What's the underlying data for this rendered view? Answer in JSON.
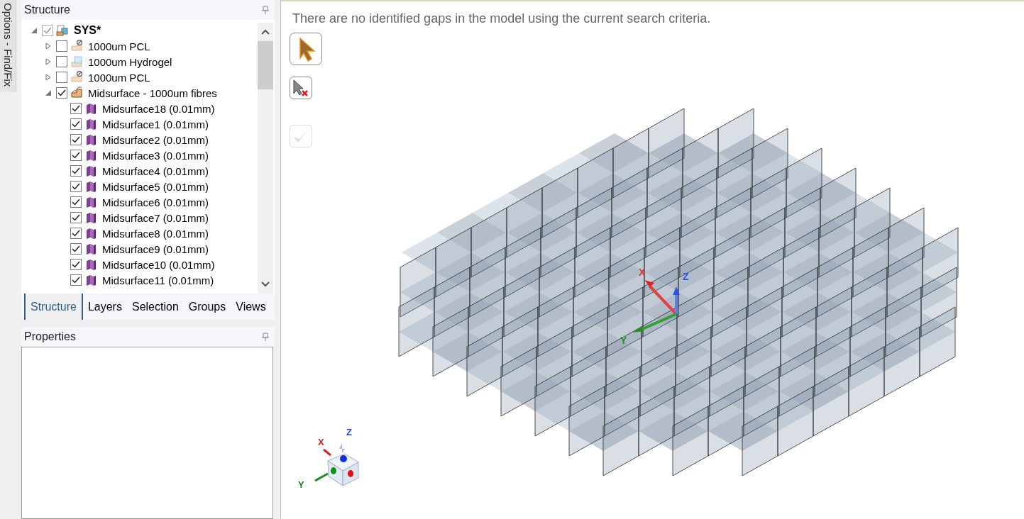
{
  "side_strip": {
    "label": "Options - Find/Fix"
  },
  "structure": {
    "title": "Structure",
    "tree": [
      {
        "label": "SYS*",
        "kind": "assembly",
        "checked": true,
        "expanded": true,
        "children": [
          {
            "label": "1000um PCL",
            "kind": "hidden-solid",
            "checked": false,
            "expanded": false
          },
          {
            "label": "1000um Hydrogel",
            "kind": "solid",
            "checked": false,
            "expanded": false
          },
          {
            "label": "1000um PCL",
            "kind": "hidden-solid",
            "checked": false,
            "expanded": false
          },
          {
            "label": "Midsurface - 1000um fibres",
            "kind": "part",
            "checked": true,
            "expanded": true,
            "children": [
              {
                "label": "Midsurface18 (0.01mm)",
                "kind": "surface",
                "checked": true
              },
              {
                "label": "Midsurface1 (0.01mm)",
                "kind": "surface",
                "checked": true
              },
              {
                "label": "Midsurface2 (0.01mm)",
                "kind": "surface",
                "checked": true
              },
              {
                "label": "Midsurface3 (0.01mm)",
                "kind": "surface",
                "checked": true
              },
              {
                "label": "Midsurface4 (0.01mm)",
                "kind": "surface",
                "checked": true
              },
              {
                "label": "Midsurface5 (0.01mm)",
                "kind": "surface",
                "checked": true
              },
              {
                "label": "Midsurface6 (0.01mm)",
                "kind": "surface",
                "checked": true
              },
              {
                "label": "Midsurface7 (0.01mm)",
                "kind": "surface",
                "checked": true
              },
              {
                "label": "Midsurface8 (0.01mm)",
                "kind": "surface",
                "checked": true
              },
              {
                "label": "Midsurface9 (0.01mm)",
                "kind": "surface",
                "checked": true
              },
              {
                "label": "Midsurface10 (0.01mm)",
                "kind": "surface",
                "checked": true
              },
              {
                "label": "Midsurface11 (0.01mm)",
                "kind": "surface",
                "checked": true
              }
            ]
          }
        ]
      }
    ]
  },
  "panel_tabs": [
    {
      "label": "Structure",
      "selected": true
    },
    {
      "label": "Layers",
      "selected": false
    },
    {
      "label": "Selection",
      "selected": false
    },
    {
      "label": "Groups",
      "selected": false
    },
    {
      "label": "Views",
      "selected": false
    }
  ],
  "properties": {
    "title": "Properties"
  },
  "viewport": {
    "message": "There are no identified gaps in the model using the current search criteria.",
    "tools": [
      {
        "kind": "select",
        "disabled": false
      },
      {
        "kind": "exclude",
        "disabled": false
      },
      {
        "kind": "complete",
        "disabled": true
      }
    ],
    "axes": {
      "x": "X",
      "y": "Y",
      "z": "Z"
    },
    "cube_axes": {
      "x": "X",
      "y": "Y",
      "z": "Z"
    }
  }
}
